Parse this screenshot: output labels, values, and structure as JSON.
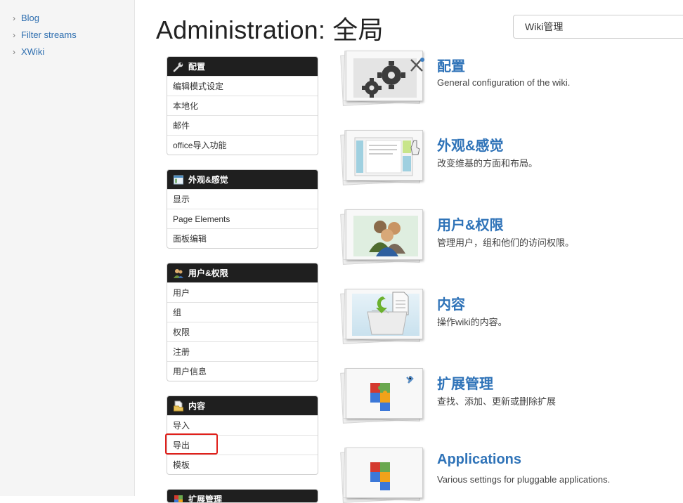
{
  "left_nav": {
    "items": [
      {
        "label": "Blog"
      },
      {
        "label": "Filter streams"
      },
      {
        "label": "XWiki"
      }
    ]
  },
  "page": {
    "title": "Administration: 全局"
  },
  "search": {
    "value": "Wiki管理"
  },
  "admin_menu": {
    "panels": [
      {
        "title": "配置",
        "icon": "wrench-icon",
        "rows": [
          "编辑模式设定",
          "本地化",
          "邮件",
          "office导入功能"
        ]
      },
      {
        "title": "外观&感觉",
        "icon": "layout-icon",
        "rows": [
          "显示",
          "Page Elements",
          "面板编辑"
        ]
      },
      {
        "title": "用户&权限",
        "icon": "users-icon",
        "rows": [
          "用户",
          "组",
          "权限",
          "注册",
          "用户信息"
        ]
      },
      {
        "title": "内容",
        "icon": "document-icon",
        "rows": [
          "导入",
          "导出",
          "模板"
        ]
      },
      {
        "title": "扩展管理",
        "icon": "puzzle-icon",
        "rows": []
      }
    ],
    "highlighted_row": "导出",
    "highlight_color": "#e0201b"
  },
  "sections": [
    {
      "title": "配置",
      "desc": "General configuration of the wiki.",
      "icon": "gears-icon"
    },
    {
      "title": "外观&感觉",
      "desc": "改变维基的方面和布局。",
      "icon": "layout-preview-icon"
    },
    {
      "title": "用户&权限",
      "desc": "管理用户，组和他们的访问权限。",
      "icon": "users-group-icon"
    },
    {
      "title": "内容",
      "desc": "操作wiki的内容。",
      "icon": "folder-import-icon"
    },
    {
      "title": "扩展管理",
      "desc": "查找、添加、更新或删除扩展",
      "icon": "puzzle-icon"
    },
    {
      "title": "Applications",
      "desc": "Various settings for pluggable applications.",
      "icon": "puzzle-icon"
    }
  ],
  "colors": {
    "link": "#2f73b8",
    "panel_header": "#1f1f1f"
  }
}
